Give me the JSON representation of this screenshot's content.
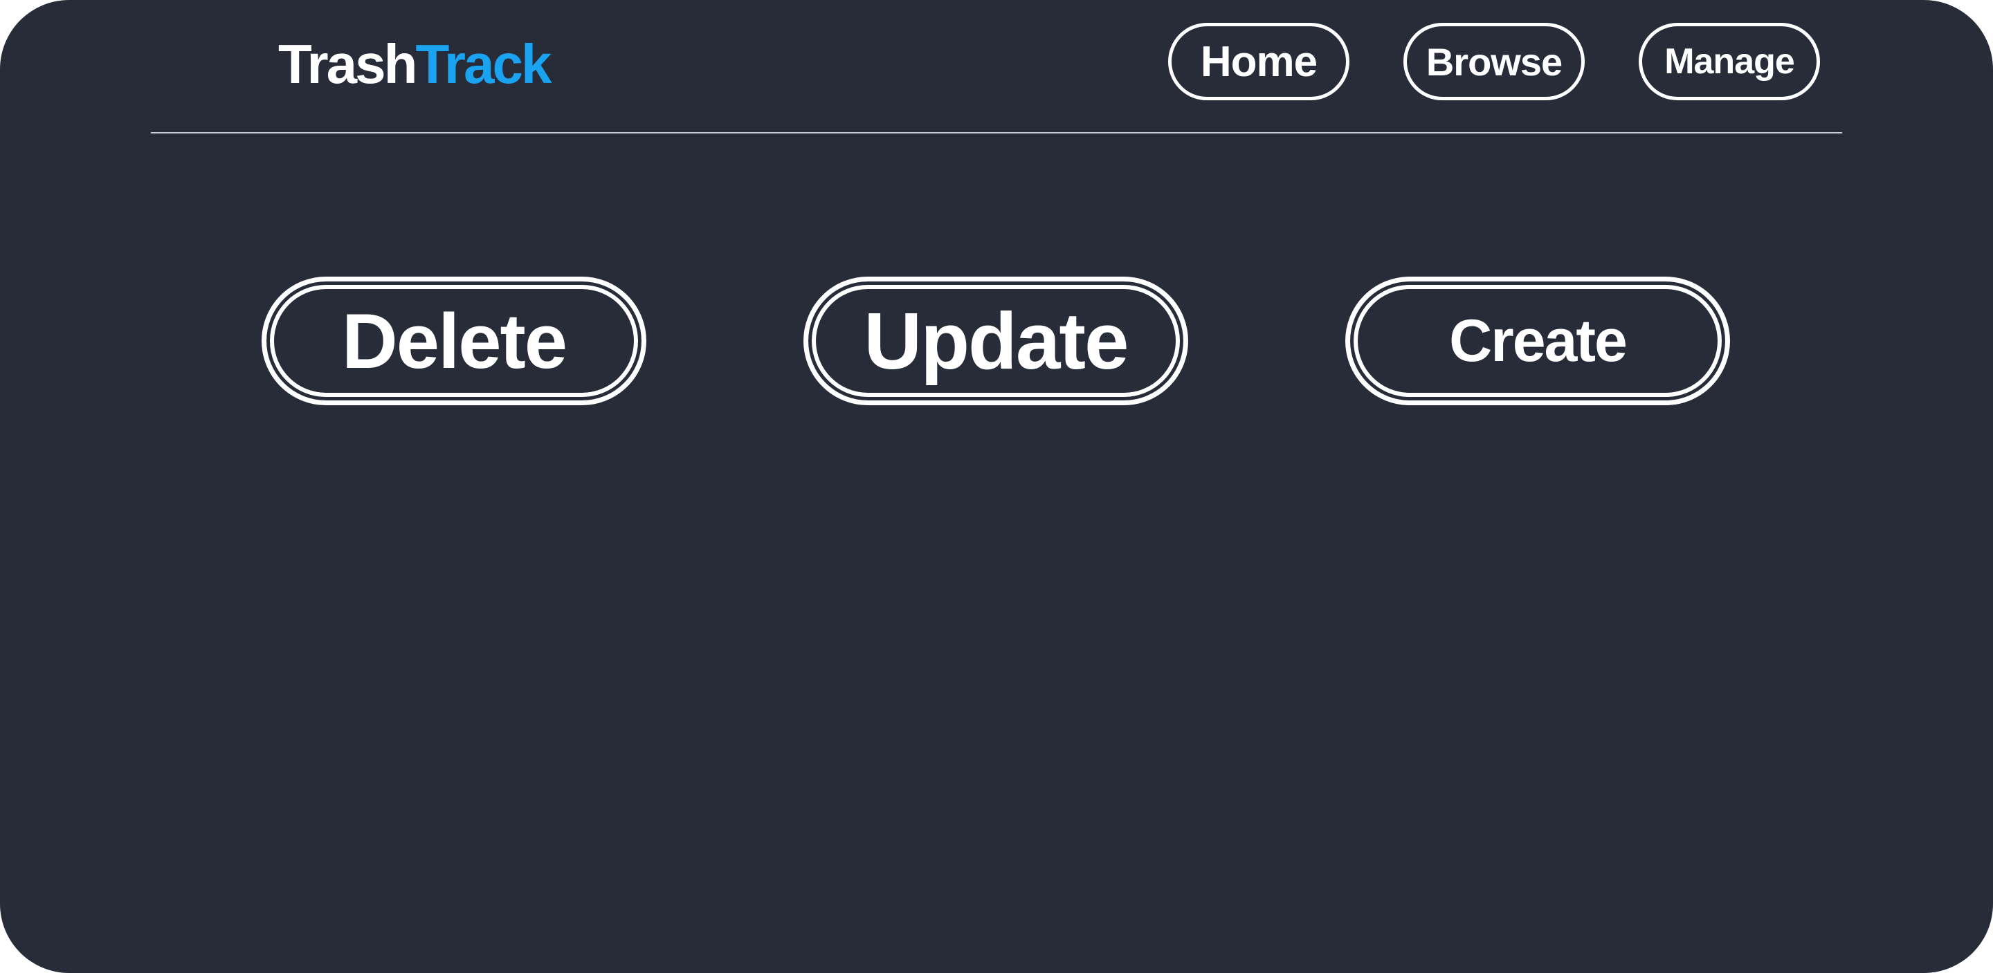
{
  "brand": {
    "name_part_1": "Trash",
    "name_part_2": "Track",
    "primary_color": "#ffffff",
    "accent_color": "#1aa3f0",
    "background_color": "#282c39"
  },
  "nav": {
    "home": "Home",
    "browse": "Browse",
    "manage": "Manage"
  },
  "actions": {
    "delete": "Delete",
    "update": "Update",
    "create": "Create"
  }
}
